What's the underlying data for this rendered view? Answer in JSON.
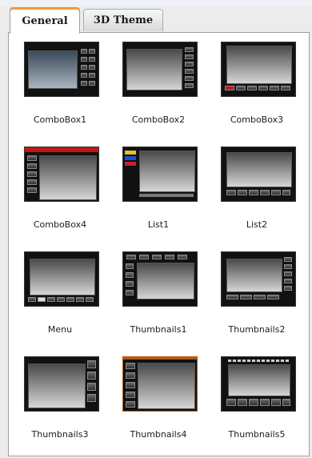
{
  "tabs": [
    {
      "label": "General",
      "active": true
    },
    {
      "label": "3D Theme",
      "active": false
    }
  ],
  "themes": [
    {
      "label": "ComboBox1",
      "icon": "combobox1-thumbnail-icon"
    },
    {
      "label": "ComboBox2",
      "icon": "combobox2-thumbnail-icon"
    },
    {
      "label": "ComboBox3",
      "icon": "combobox3-thumbnail-icon"
    },
    {
      "label": "ComboBox4",
      "icon": "combobox4-thumbnail-icon"
    },
    {
      "label": "List1",
      "icon": "list1-thumbnail-icon"
    },
    {
      "label": "List2",
      "icon": "list2-thumbnail-icon"
    },
    {
      "label": "Menu",
      "icon": "menu-thumbnail-icon"
    },
    {
      "label": "Thumbnails1",
      "icon": "thumbnails1-thumbnail-icon"
    },
    {
      "label": "Thumbnails2",
      "icon": "thumbnails2-thumbnail-icon"
    },
    {
      "label": "Thumbnails3",
      "icon": "thumbnails3-thumbnail-icon"
    },
    {
      "label": "Thumbnails4",
      "icon": "thumbnails4-thumbnail-icon"
    },
    {
      "label": "Thumbnails5",
      "icon": "thumbnails5-thumbnail-icon"
    }
  ],
  "colors": {
    "active_tab_accent": "#ff9a2f",
    "list1_bar_colors": [
      "#e3c21e",
      "#1e4fd8",
      "#c8232c"
    ],
    "combobox4_header": "#c41616"
  }
}
